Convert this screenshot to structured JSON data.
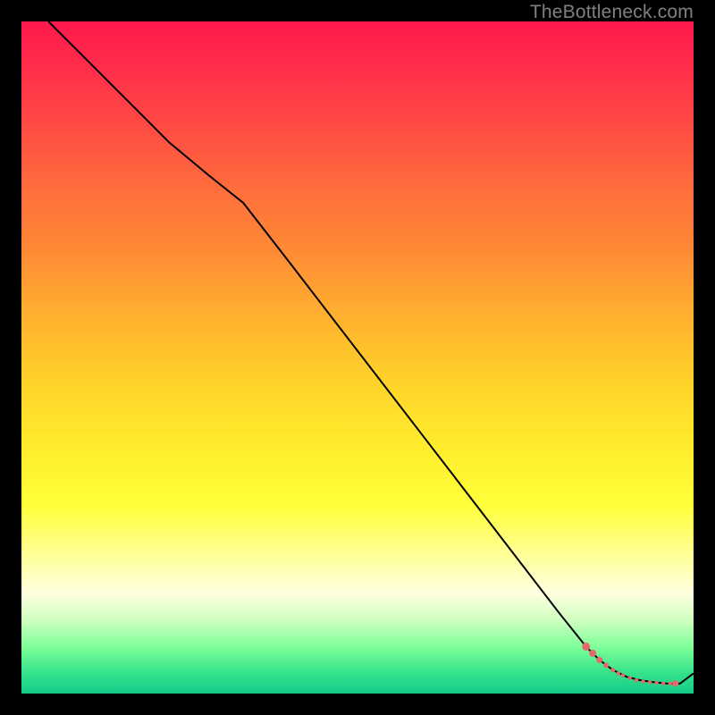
{
  "watermark": "TheBottleneck.com",
  "colors": {
    "page_bg": "#000000",
    "line": "#000000",
    "marker": "#e46a6a",
    "gradient_top": "#ff1a4d",
    "gradient_bottom": "#14cc88"
  },
  "chart_data": {
    "type": "line",
    "title": "",
    "subtitle": "",
    "xlabel": "",
    "ylabel": "",
    "xlim": [
      0,
      100
    ],
    "ylim": [
      0,
      100
    ],
    "grid": false,
    "legend": false,
    "series": [
      {
        "name": "curve",
        "x": [
          4,
          10,
          16,
          22,
          28,
          33,
          40,
          50,
          60,
          70,
          80,
          84,
          86,
          88,
          90,
          92,
          94,
          96,
          98,
          100
        ],
        "y": [
          100,
          94,
          88,
          82,
          77,
          73,
          64,
          51,
          38,
          25,
          12,
          7,
          5,
          3.5,
          2.5,
          2,
          1.7,
          1.5,
          1.5,
          3
        ],
        "stroke": "#000000",
        "stroke_width": 2
      }
    ],
    "markers": {
      "name": "dotted-segment",
      "color": "#e46a6a",
      "radius_small": 2.5,
      "radius_large": 4.5,
      "points": [
        {
          "x": 84.0,
          "y": 7.0,
          "r": 4.5
        },
        {
          "x": 85.0,
          "y": 6.0,
          "r": 4.0
        },
        {
          "x": 86.0,
          "y": 5.0,
          "r": 3.5
        },
        {
          "x": 87.0,
          "y": 4.2,
          "r": 3.0
        },
        {
          "x": 88.0,
          "y": 3.5,
          "r": 2.5
        },
        {
          "x": 88.8,
          "y": 3.0,
          "r": 2.2
        },
        {
          "x": 89.5,
          "y": 2.7,
          "r": 2.2
        },
        {
          "x": 90.5,
          "y": 2.3,
          "r": 2.2
        },
        {
          "x": 91.5,
          "y": 2.0,
          "r": 2.2
        },
        {
          "x": 92.5,
          "y": 1.8,
          "r": 2.2
        },
        {
          "x": 93.5,
          "y": 1.7,
          "r": 2.2
        },
        {
          "x": 94.5,
          "y": 1.6,
          "r": 2.2
        },
        {
          "x": 95.5,
          "y": 1.5,
          "r": 2.2
        },
        {
          "x": 96.5,
          "y": 1.5,
          "r": 2.2
        },
        {
          "x": 97.3,
          "y": 1.5,
          "r": 3.5
        }
      ]
    }
  }
}
